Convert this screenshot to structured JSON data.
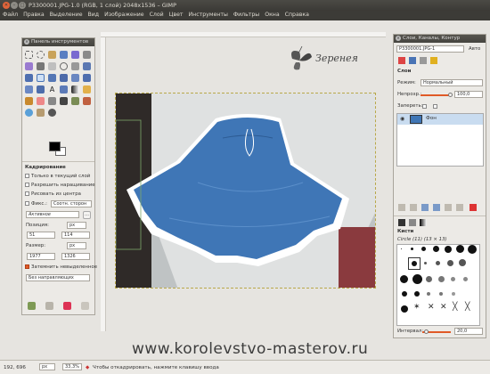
{
  "window": {
    "title": "P3300001.JPG-1.0 (RGB, 1 слой) 2048x1536 – GIMP"
  },
  "menu": [
    "Файл",
    "Правка",
    "Выделение",
    "Вид",
    "Изображение",
    "Слой",
    "Цвет",
    "Инструменты",
    "Фильтры",
    "Окна",
    "Справка"
  ],
  "toolbox": {
    "title": "Панель инструментов",
    "options_title": "Кадрирование",
    "options": {
      "current_layer_only": "Только в текущий слой",
      "allow_growing": "Разрешить наращивание",
      "expand_from_center": "Рисовать из центра",
      "fixed": "Фикс.:",
      "fixed_value": "Соотн. сторон",
      "aspect_value": "Активное",
      "position_label": "Позиция:",
      "position_unit": "px",
      "position_x": "51",
      "position_y": "114",
      "size_label": "Размер:",
      "size_unit": "px",
      "size_w": "1977",
      "size_h": "1326",
      "shade": "Затемнить невыделенное",
      "guides": "Без направляющих"
    }
  },
  "layers_panel": {
    "title": "Слои, Каналы, Контур",
    "image_select": "P3300001.JPG-1",
    "auto_label": "Авто",
    "section": "Слои",
    "mode_label": "Режим:",
    "mode_value": "Нормальный",
    "opacity_label": "Непрозр.:",
    "opacity_value": "100,0",
    "lock_label": "Запереть:",
    "layer_name": "Фон"
  },
  "brushes_panel": {
    "section": "Кисти",
    "brush_name": "Circle (11) (13 × 13)",
    "spacing_label": "Интервал:",
    "spacing_value": "20,0"
  },
  "status": {
    "coords": "192, 696",
    "unit": "px",
    "zoom": "33,3%",
    "message": "Чтобы откадрировать, нажмите клавишу ввода"
  },
  "logo_text": "Зеренея",
  "watermark": "www.korolevstvo-masterov.ru",
  "colors": {
    "menubar": "#3c3b37",
    "skirt": "#3f76b6",
    "accent": "#e05a27"
  }
}
